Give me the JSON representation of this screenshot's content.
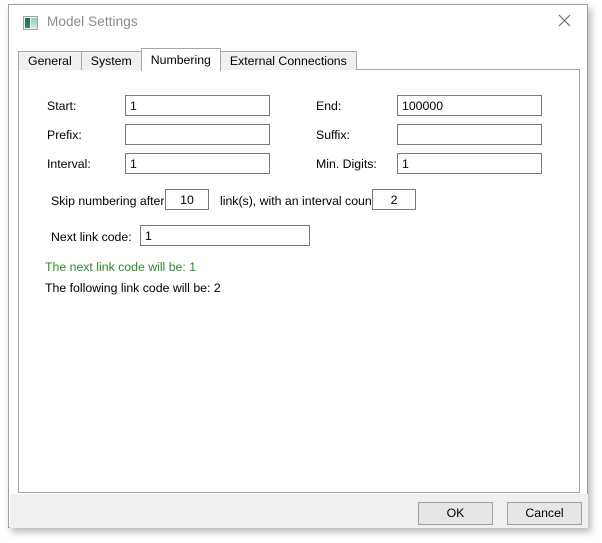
{
  "window": {
    "title": "Model Settings",
    "icon": "application-window-icon",
    "close_label": "✕"
  },
  "tabs": [
    {
      "label": "General",
      "active": false
    },
    {
      "label": "System",
      "active": false
    },
    {
      "label": "Numbering",
      "active": true
    },
    {
      "label": "External Connections",
      "active": false
    }
  ],
  "form": {
    "start": {
      "label": "Start:",
      "value": "1"
    },
    "prefix": {
      "label": "Prefix:",
      "value": ""
    },
    "interval": {
      "label": "Interval:",
      "value": "1"
    },
    "end": {
      "label": "End:",
      "value": "100000"
    },
    "suffix": {
      "label": "Suffix:",
      "value": ""
    },
    "min_digits": {
      "label": "Min. Digits:",
      "value": "1"
    },
    "skip": {
      "prefix_text": "Skip numbering after",
      "links_value": "10",
      "middle_text": "link(s), with an interval count of",
      "interval_count_value": "2"
    },
    "next_link_code": {
      "label": "Next link code:",
      "value": "1"
    }
  },
  "status": {
    "next_line": "The next link code will be: 1",
    "following_line": "The following link code will be: 2",
    "next_line_color": "#2c8a2c",
    "following_line_color": "#000000"
  },
  "footer": {
    "ok_label": "OK",
    "cancel_label": "Cancel"
  }
}
